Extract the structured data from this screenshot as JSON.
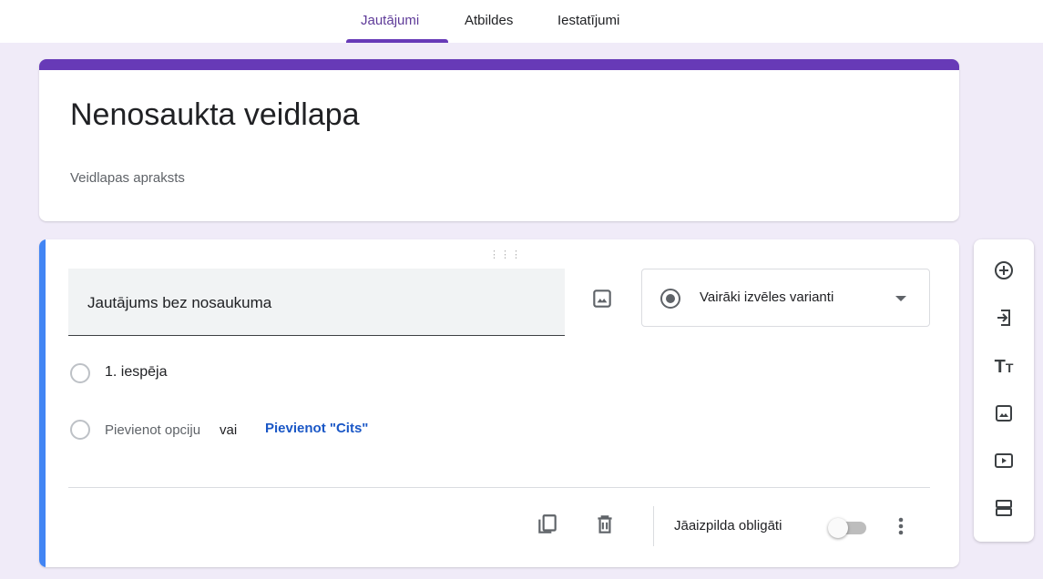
{
  "tabs": [
    {
      "label": "Jautājumi",
      "active": true
    },
    {
      "label": "Atbildes",
      "active": false
    },
    {
      "label": "Iestatījumi",
      "active": false
    }
  ],
  "form": {
    "title": "Nenosaukta veidlapa",
    "description": "Veidlapas apraksts"
  },
  "question": {
    "title": "Jautājums bez nosaukuma",
    "type": "Vairāki izvēles varianti",
    "options": [
      "1. iespēja"
    ],
    "add_option": "Pievienot opciju",
    "or": "vai",
    "add_other": "Pievienot \"Cits\"",
    "required_label": "Jāaizpilda obligāti",
    "required": false
  },
  "side_tools": [
    "add-question-icon",
    "import-questions-icon",
    "add-title-icon",
    "add-image-icon",
    "add-video-icon",
    "add-section-icon"
  ],
  "colors": {
    "accent": "#673ab7",
    "active_question_bar": "#4285f4",
    "background": "#f0ebf8",
    "link": "#1a57c6"
  }
}
